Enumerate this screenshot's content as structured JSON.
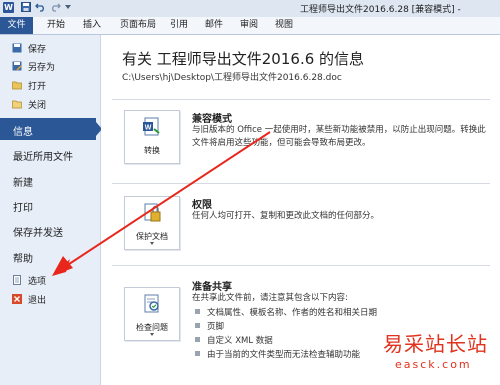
{
  "window": {
    "title": "工程师导出文件2016.6.28 [兼容模式] -",
    "app_icon": "W"
  },
  "quick_access": [
    "save-icon",
    "undo-icon",
    "redo-icon"
  ],
  "tabs": [
    "文件",
    "开始",
    "插入",
    "页面布局",
    "引用",
    "邮件",
    "审阅",
    "视图"
  ],
  "sidebar": {
    "top_items": [
      {
        "label": "保存",
        "icon": "save-icon"
      },
      {
        "label": "另存为",
        "icon": "save-as-icon"
      },
      {
        "label": "打开",
        "icon": "open-folder-icon"
      },
      {
        "label": "关闭",
        "icon": "close-doc-icon"
      }
    ],
    "nav_items": [
      "信息",
      "最近所用文件",
      "新建",
      "打印",
      "保存并发送",
      "帮助"
    ],
    "bottom_items": [
      {
        "label": "选项",
        "icon": "options-icon"
      },
      {
        "label": "退出",
        "icon": "exit-icon"
      }
    ]
  },
  "main": {
    "title": "有关 工程师导出文件2016.6 的信息",
    "path": "C:\\Users\\hj\\Desktop\\工程师导出文件2016.6.28.doc",
    "sections": [
      {
        "button_label": "转换",
        "heading": "兼容模式",
        "description": "与旧版本的 Office 一起使用时，某些新功能被禁用，以防止出现问题。转换此文件将启用这些功能，但可能会导致布局更改。"
      },
      {
        "button_label": "保护文档",
        "heading": "权限",
        "description": "任何人均可打开、复制和更改此文档的任何部分。"
      },
      {
        "button_label": "检查问题",
        "heading": "准备共享",
        "description": "在共享此文件前，请注意其包含以下内容:",
        "bullets": [
          "文档属性、模板名称、作者的姓名和相关日期",
          "页脚",
          "自定义 XML 数据",
          "由于当前的文件类型而无法检查辅助功能"
        ]
      }
    ]
  },
  "watermark": {
    "text_cn": "易采站长站",
    "text_en": "easck.com"
  },
  "annotation_color": "#e8261c"
}
